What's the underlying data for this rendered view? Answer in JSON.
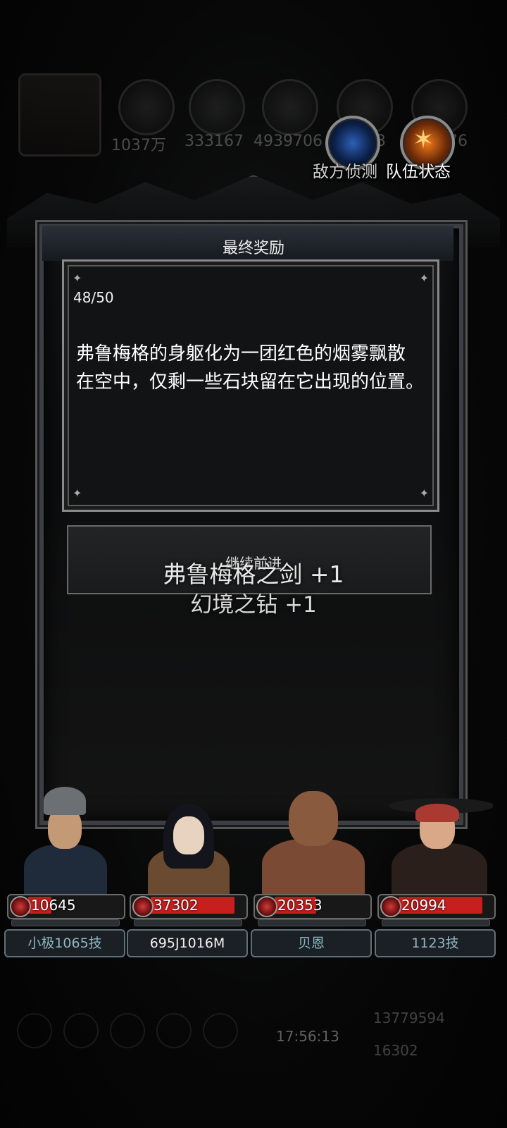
{
  "background_hud": {
    "resources": [
      "1037万",
      "333167",
      "4939706",
      "543",
      "376"
    ],
    "bottom_numbers": [
      "13779594",
      "16302"
    ],
    "clock": "17:56:13"
  },
  "top_buttons": {
    "scout_label": "敌方侦测",
    "team_label": "队伍状态"
  },
  "panel": {
    "title": "最终奖励",
    "progress": "48/50",
    "story_line1": "弗鲁梅格的身躯化为一团红色的烟雾飘散",
    "story_line2": "在空中，仅剩一些石块留在它出现的位置。",
    "continue_label": "继续前进"
  },
  "rewards": [
    {
      "text": "弗鲁梅格之剑 +1"
    },
    {
      "text": "幻境之钻 +1"
    }
  ],
  "heroes": [
    {
      "hp": "10645",
      "hp_fraction": 0.25,
      "name": "小极1065技"
    },
    {
      "hp": "37302",
      "hp_fraction": 0.9,
      "name": "695J1016M"
    },
    {
      "hp": "20353",
      "hp_fraction": 0.45,
      "name": "贝恩"
    },
    {
      "hp": "20994",
      "hp_fraction": 0.9,
      "name": "1123技"
    }
  ],
  "colors": {
    "hp_red": "#c81e1e",
    "name_teal": "#8fb6c4",
    "panel_dark": "#121314"
  }
}
